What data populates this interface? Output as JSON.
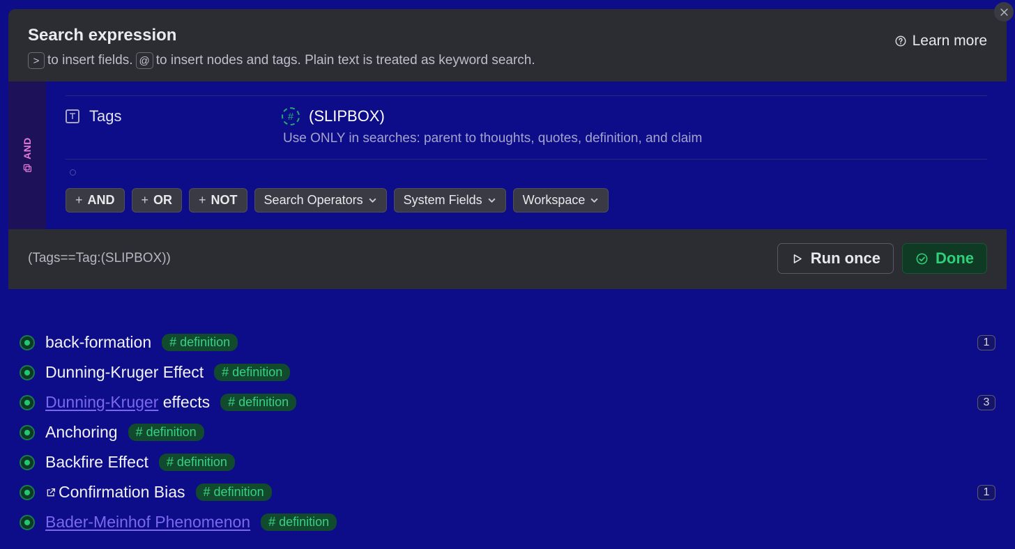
{
  "header": {
    "title": "Search expression",
    "hint_key1": ">",
    "hint_part1": "to insert fields.",
    "hint_key2": "@",
    "hint_part2": "to insert nodes and tags. Plain text is treated as keyword search.",
    "learn_more": "Learn more"
  },
  "gutter": {
    "label": "AND"
  },
  "criteria": {
    "field_label": "Tags",
    "tag_name": "(SLIPBOX)",
    "tag_desc": "Use ONLY in searches: parent to thoughts, quotes, definition, and claim"
  },
  "operators": {
    "and": "AND",
    "or": "OR",
    "not": "NOT",
    "search_operators": "Search Operators",
    "system_fields": "System Fields",
    "workspace": "Workspace"
  },
  "footer": {
    "expression": "(Tags==Tag:(SLIPBOX))",
    "run": "Run once",
    "done": "Done"
  },
  "results": [
    {
      "title": "back-formation",
      "tag": "# definition",
      "count": "1"
    },
    {
      "title": "Dunning-Kruger Effect",
      "tag": "# definition"
    },
    {
      "link_part": "Dunning-Kruger",
      "rest": " effects",
      "tag": "# definition",
      "count": "3"
    },
    {
      "title": "Anchoring",
      "tag": "# definition"
    },
    {
      "title": "Backfire Effect",
      "tag": "# definition"
    },
    {
      "external": true,
      "title": "Confirmation Bias",
      "tag": "# definition",
      "count": "1"
    },
    {
      "link_full": "Bader-Meinhof Phenomenon",
      "tag": "# definition"
    }
  ]
}
